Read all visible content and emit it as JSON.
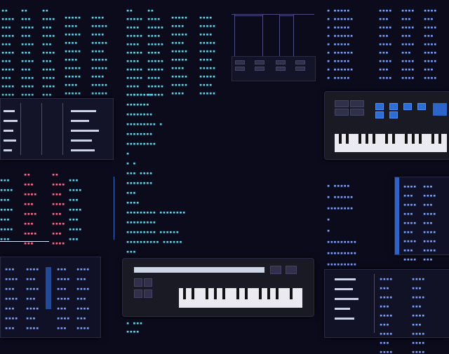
{
  "palette": {
    "background": "#0b0b1c",
    "text_cyan": "#5fd3e8",
    "text_blue": "#7aa2ff",
    "text_pink": "#ff6b8b",
    "accent_blue": "#2c64c9"
  },
  "blocks": {
    "top_left": {
      "headers": [
        "▪▪",
        "▪▪",
        "▪▪"
      ],
      "rows": [
        "▪▪▪▪",
        "▪▪▪",
        "▪▪▪▪",
        "▪▪▪",
        "▪▪▪▪",
        "▪▪▪",
        "▪▪▪▪",
        "▪▪▪",
        "▪▪▪▪",
        "▪▪▪▪"
      ]
    },
    "top_center": {
      "headers": [
        "▪▪",
        "▪▪"
      ],
      "rows": [
        "▪▪▪▪▪",
        "▪▪▪▪",
        "▪▪▪▪▪",
        "▪▪▪▪",
        "▪▪▪▪▪",
        "▪▪▪▪",
        "▪▪▪▪▪",
        "▪▪▪▪▪",
        "▪▪▪▪",
        "▪▪▪▪▪"
      ]
    },
    "middle_list": {
      "rows": [
        "▪ ▪▪▪▪▪▪",
        "▪▪▪▪▪▪▪",
        "▪▪▪▪▪▪▪▪",
        "▪▪▪▪▪▪▪▪▪ ▪",
        "▪▪▪▪▪▪▪▪",
        "▪▪▪▪▪▪▪▪▪",
        "▪",
        "▪ ▪",
        "▪▪▪ ▪▪▪▪",
        "▪▪▪▪▪▪▪▪",
        "▪▪▪",
        "▪▪▪▪",
        "▪▪▪▪▪▪▪▪▪ ▪▪▪▪▪▪▪▪",
        "▪▪▪▪▪▪▪▪▪",
        "▪▪▪▪▪▪▪▪▪ ▪▪▪▪▪▪",
        "▪▪▪▪▪▪▪▪▪▪ ▪▪▪▪▪▪",
        "▪▪▪",
        "▪▪ ▪▪▪▪▪▪"
      ]
    },
    "left_mid": {
      "headers": [
        "▪▪",
        "▪▪"
      ],
      "rows": [
        "▪▪▪",
        "▪▪▪▪",
        "▪▪▪",
        "▪▪▪▪",
        "▪▪▪",
        "▪▪▪▪",
        "▪▪▪",
        "▪▪▪▪"
      ]
    },
    "right_list": {
      "rows": [
        "▪ ▪▪▪▪▪",
        "▪ ▪▪▪▪▪▪",
        "▪ ▪▪▪▪▪",
        "▪ ▪▪▪▪▪▪",
        "▪ ▪▪▪▪▪",
        "▪ ▪▪▪▪▪▪",
        "▪ ▪▪▪▪▪",
        "▪ ▪▪▪▪▪▪",
        "▪ ▪▪▪▪▪"
      ]
    },
    "right_mid": {
      "rows": [
        "▪ ▪▪▪▪▪",
        "▪ ▪▪▪▪▪▪",
        "▪▪▪▪▪▪▪▪",
        "▪",
        "▪",
        "▪▪▪▪▪▪▪▪▪",
        "▪▪▪▪▪▪▪▪▪",
        "▪▪▪▪▪▪▪▪▪"
      ]
    },
    "bottom_text": {
      "rows": [
        "▪ ▪▪▪",
        "▪▪▪▪"
      ]
    }
  }
}
